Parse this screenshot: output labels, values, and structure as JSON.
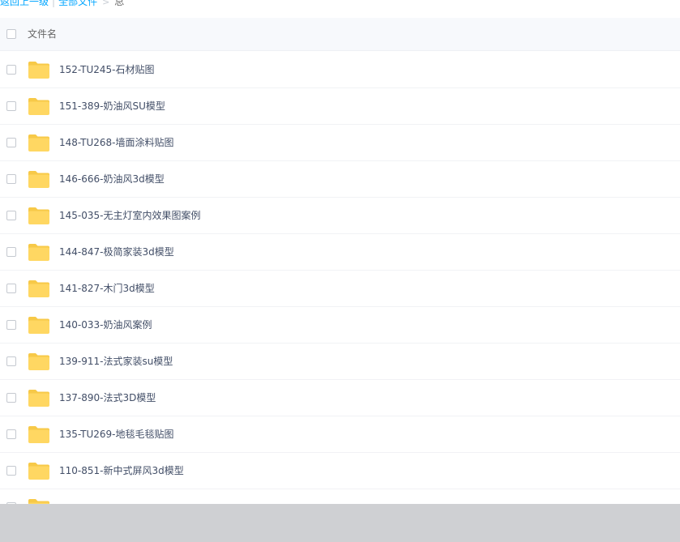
{
  "breadcrumb": {
    "back": "返回上一级",
    "all_files": "全部文件",
    "current": "总"
  },
  "list": {
    "header_label": "文件名",
    "rows": [
      {
        "name": "152-TU245-石材贴图"
      },
      {
        "name": "151-389-奶油风SU模型"
      },
      {
        "name": "148-TU268-墙面涂料贴图"
      },
      {
        "name": "146-666-奶油风3d模型"
      },
      {
        "name": "145-035-无主灯室内效果图案例"
      },
      {
        "name": "144-847-极简家装3d模型"
      },
      {
        "name": "141-827-木门3d模型"
      },
      {
        "name": "140-033-奶油风案例"
      },
      {
        "name": "139-911-法式家装su模型"
      },
      {
        "name": "137-890-法式3D模型"
      },
      {
        "name": "135-TU269-地毯毛毯贴图"
      },
      {
        "name": "110-851-新中式屏风3d模型"
      },
      {
        "name": ""
      }
    ]
  },
  "colors": {
    "link": "#06a7ff",
    "folder": "#ffd762",
    "folder_tab": "#f7c948",
    "text": "#424e67",
    "header_bg": "#f7f9fc",
    "bottom_strip": "#cfd0d3"
  },
  "icons": {
    "row_icon": "folder-icon",
    "breadcrumb_separator": "chevron-right-icon"
  }
}
